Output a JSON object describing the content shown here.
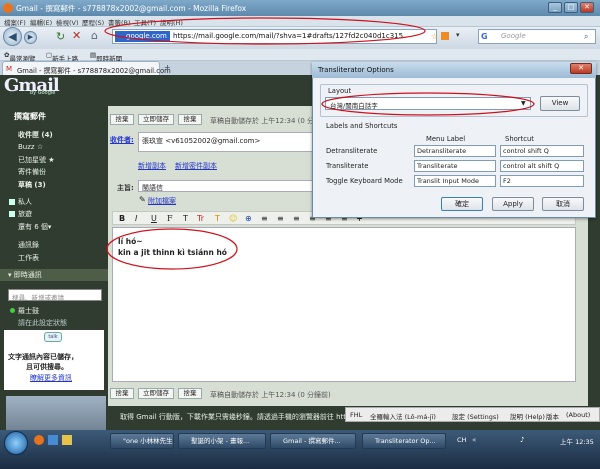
{
  "window": {
    "title": "Gmail - 撰寫郵件 - s778878x2002@gmail.com - Mozilla Firefox",
    "min": "_",
    "max": "□",
    "close": "✕"
  },
  "menu": {
    "items": [
      "檔案(F)",
      "編輯(E)",
      "檢視(V)",
      "歷程(S)",
      "書籤(B)",
      "工具(T)",
      "說明(H)"
    ]
  },
  "nav": {
    "site": "google.com",
    "url": "https://mail.google.com/mail/?shva=1#drafts/127fd2c040d1c315",
    "search_placeholder": "Google"
  },
  "bookmarks": [
    "最常瀏覽",
    "新手上路",
    "即時新聞"
  ],
  "tab": {
    "title": "Gmail - 撰寫郵件 - s778878x2002@gmail.com"
  },
  "gmail": {
    "logo": "Gmail",
    "by": "by Google",
    "compose_link": "撰寫郵件",
    "nav": [
      {
        "label": "收件匣 (4)",
        "bold": true
      },
      {
        "label": "Buzz ☆",
        "bold": false
      },
      {
        "label": "已加星號 ★",
        "bold": false
      },
      {
        "label": "寄件備份",
        "bold": false
      },
      {
        "label": "草稿 (3)",
        "bold": true
      }
    ],
    "labels": [
      "私人",
      "旅遊",
      "還有 6 個▾"
    ],
    "extra": [
      "通訊錄",
      "工作表"
    ],
    "chat_header": "即時通訊",
    "chat_search_placeholder": "搜尋、新增或邀請",
    "chat_user": "羅士鼓",
    "chat_status": "請在此設定狀態",
    "talk_text1": "文字通訊內容已儲存，",
    "talk_text2": "且可供搜尋。",
    "talk_link": "瞭解更多資訊",
    "talk_icon": "talk"
  },
  "compose": {
    "btn_discard": "捨棄",
    "btn_save": "立即儲存",
    "btn_cancel": "捨棄",
    "autosave": "草稿自動儲存於 上午12:34 (0 分鐘前)",
    "autosave_bottom": "草稿自動儲存於 上午12:34 (0 分鐘前)",
    "to_label": "收件者:",
    "to_value": "張玖宣 <v61052002@gmail.com>",
    "add_cc": "新增副本",
    "add_bcc": "新增密件副本",
    "subject_label": "主旨:",
    "subject_value": "閩語信",
    "attach": "附加檔案",
    "fmt_tools": [
      "B",
      "I",
      "U",
      "F",
      "T",
      "Tr",
      "T",
      "☺",
      "⊕",
      "≡",
      "≡",
      "≡",
      "≡",
      "≡",
      "≡",
      "T"
    ],
    "body_line1": "lí hó~",
    "body_line2": "kin a jit thinn kì tsiánn hó"
  },
  "dialog": {
    "title": "Transliterator Options",
    "layout_label": "Layout",
    "layout_value": "台灣/閩南白話字",
    "view_btn": "View",
    "section": "Labels and Shortcuts",
    "col_menu": "Menu Label",
    "col_shortcut": "Shortcut",
    "rows": [
      {
        "name": "Detransliterate",
        "label": "Detransliterate",
        "shortcut": "control shift Q"
      },
      {
        "name": "Transliterate",
        "label": "Transliterate",
        "shortcut": "control alt shift Q"
      },
      {
        "name": "Toggle Keyboard Mode",
        "label": "Translit Input Mode",
        "shortcut": "F2"
      }
    ],
    "ok": "確定",
    "apply": "Apply",
    "cancel": "取消"
  },
  "footer": {
    "text": "取得 Gmail 行動版，下載作業只需幾秒鐘。請透過手機的瀏覽器前往 http://m.google.com/mail/"
  },
  "status": {
    "fhl": "FHL",
    "input": "全羅輸入法 (Lô-má-jī)",
    "settings": "設定 (Settings)",
    "help": "說明 (Help)",
    "about_cn": "版本",
    "about": "(About)"
  },
  "taskbar": {
    "items": [
      "\"one 小林林先生...",
      "聖誕的小架 - 畫報...",
      "Gmail - 撰寫郵件...",
      "Transliterator Op..."
    ],
    "lang": "CH",
    "clock": "上午 12:35"
  },
  "annotations": {
    "color": "#d0101a"
  }
}
